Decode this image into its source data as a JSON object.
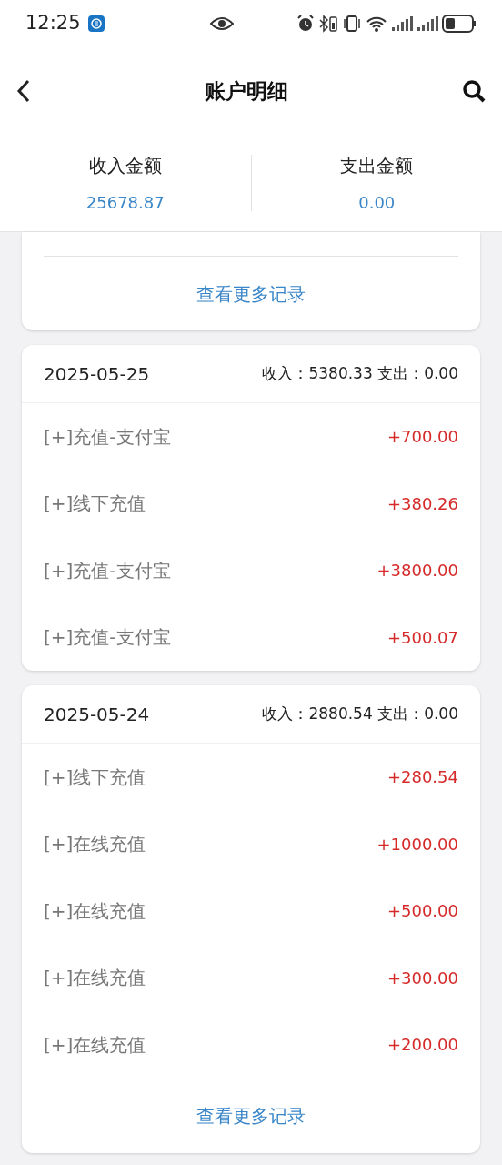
{
  "status_bar": {
    "time": "12:25"
  },
  "header": {
    "title": "账户明细"
  },
  "summary": [
    {
      "label": "收入金额",
      "value": "25678.87"
    },
    {
      "label": "支出金额",
      "value": "0.00"
    }
  ],
  "groups": [
    {
      "more_link": "查看更多记录"
    },
    {
      "date": "2025-05-25",
      "totals": "收入：5380.33 支出：0.00",
      "rows": [
        {
          "title": "[+]充值-支付宝",
          "amount": "+700.00"
        },
        {
          "title": "[+]线下充值",
          "amount": "+380.26"
        },
        {
          "title": "[+]充值-支付宝",
          "amount": "+3800.00"
        },
        {
          "title": "[+]充值-支付宝",
          "amount": "+500.07"
        }
      ]
    },
    {
      "date": "2025-05-24",
      "totals": "收入：2880.54 支出：0.00",
      "rows": [
        {
          "title": "[+]线下充值",
          "amount": "+280.54"
        },
        {
          "title": "[+]在线充值",
          "amount": "+1000.00"
        },
        {
          "title": "[+]在线充值",
          "amount": "+500.00"
        },
        {
          "title": "[+]在线充值",
          "amount": "+300.00"
        },
        {
          "title": "[+]在线充值",
          "amount": "+200.00"
        }
      ],
      "more_link": "查看更多记录"
    }
  ]
}
